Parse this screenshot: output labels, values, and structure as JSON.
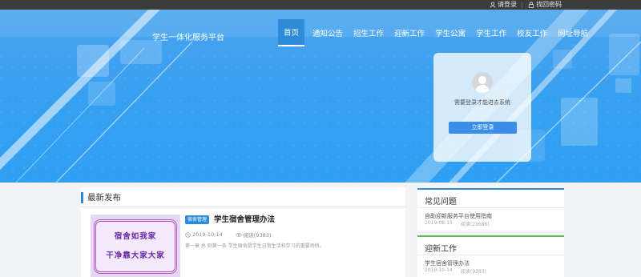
{
  "topbar": {
    "login_label": "请登录",
    "find_password_label": "找回密码"
  },
  "header": {
    "site_title": "学生一体化服务平台",
    "nav": [
      {
        "label": "首页",
        "active": true
      },
      {
        "label": "通知公告"
      },
      {
        "label": "招生工作"
      },
      {
        "label": "迎新工作"
      },
      {
        "label": "学生公寓"
      },
      {
        "label": "学生工作"
      },
      {
        "label": "校友工作"
      },
      {
        "label": "网址导航"
      }
    ]
  },
  "login_card": {
    "tip": "需要登录才能进去系统",
    "button_label": "立即登录"
  },
  "latest": {
    "section_title": "最新发布",
    "post": {
      "tag": "宿舍管理",
      "title": "学生宿舍管理办法",
      "date": "2019-10-14",
      "views": "阅读(9383)",
      "excerpt": "第一章  总   则第一条  学生宿舍是学生日常生活和学习的重要场所。",
      "thumbnail_line1": "宿舍如我家",
      "thumbnail_line2": "干净靠大家大家"
    }
  },
  "faq": {
    "title": "常见问题",
    "item": "自助迎新服务平台使用指南",
    "date": "2019-08-15",
    "views": "阅读(25686)"
  },
  "yingxin": {
    "title": "迎新工作",
    "item": "学生宿舍管理办法",
    "date": "2019-10-14",
    "views": "阅读(9383)"
  },
  "colors": {
    "topbar": "#3c3c3c",
    "hero": "#36a0f0",
    "accent": "#2d8bd8",
    "green": "#5cb85c"
  }
}
